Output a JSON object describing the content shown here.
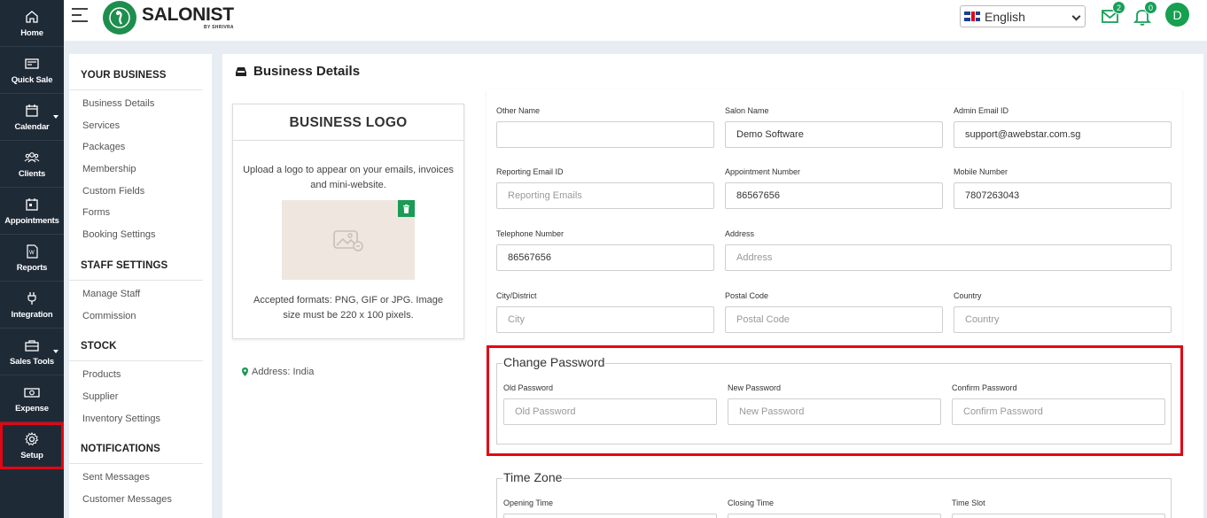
{
  "rail": [
    {
      "label": "Home",
      "icon": "home-icon"
    },
    {
      "label": "Quick Sale",
      "icon": "register-icon"
    },
    {
      "label": "Calendar",
      "icon": "calendar-icon",
      "caret": true
    },
    {
      "label": "Clients",
      "icon": "users-icon"
    },
    {
      "label": "Appointments",
      "icon": "appointment-icon"
    },
    {
      "label": "Reports",
      "icon": "report-icon"
    },
    {
      "label": "Integration",
      "icon": "plug-icon"
    },
    {
      "label": "Sales Tools",
      "icon": "briefcase-icon",
      "caret": true
    },
    {
      "label": "Expense",
      "icon": "money-icon"
    },
    {
      "label": "Setup",
      "icon": "gear-icon",
      "active": true
    }
  ],
  "header": {
    "brand": "SALONIST",
    "brand_sub": "BY SHRIVRA",
    "language": "English",
    "mail_badge": "2",
    "bell_badge": "0",
    "avatar": "D"
  },
  "subnav": {
    "sections": [
      {
        "title": "YOUR BUSINESS",
        "items": [
          "Business Details",
          "Services",
          "Packages",
          "Membership",
          "Custom Fields",
          "Forms",
          "Booking Settings"
        ]
      },
      {
        "title": "STAFF SETTINGS",
        "items": [
          "Manage Staff",
          "Commission"
        ]
      },
      {
        "title": "STOCK",
        "items": [
          "Products",
          "Supplier",
          "Inventory Settings"
        ]
      },
      {
        "title": "NOTIFICATIONS",
        "items": [
          "Sent Messages",
          "Customer Messages"
        ]
      }
    ]
  },
  "main": {
    "title": "Business Details",
    "logo_card": {
      "title": "BUSINESS LOGO",
      "description": "Upload a logo to appear on your emails, invoices and mini-website.",
      "formats": "Accepted formats: PNG, GIF or JPG. Image size must be 220 x 100 pixels."
    },
    "address_note": "Address: India",
    "fields": {
      "other_name": {
        "label": "Other Name",
        "value": "",
        "placeholder": ""
      },
      "salon_name": {
        "label": "Salon Name",
        "value": "Demo Software"
      },
      "admin_email": {
        "label": "Admin Email ID",
        "value": "support@awebstar.com.sg"
      },
      "reporting_email": {
        "label": "Reporting Email ID",
        "placeholder": "Reporting Emails"
      },
      "appointment_number": {
        "label": "Appointment Number",
        "value": "86567656"
      },
      "mobile_number": {
        "label": "Mobile Number",
        "value": "7807263043"
      },
      "telephone_number": {
        "label": "Telephone Number",
        "value": "86567656"
      },
      "address": {
        "label": "Address",
        "placeholder": "Address"
      },
      "city": {
        "label": "City/District",
        "placeholder": "City"
      },
      "postal_code": {
        "label": "Postal Code",
        "placeholder": "Postal Code"
      },
      "country": {
        "label": "Country",
        "placeholder": "Country"
      }
    },
    "change_password": {
      "legend": "Change Password",
      "old": {
        "label": "Old Password",
        "placeholder": "Old Password"
      },
      "new": {
        "label": "New Password",
        "placeholder": "New Password"
      },
      "confirm": {
        "label": "Confirm Password",
        "placeholder": "Confirm Password"
      }
    },
    "time_zone": {
      "legend": "Time Zone",
      "opening": {
        "label": "Opening Time"
      },
      "closing": {
        "label": "Closing Time"
      },
      "slot": {
        "label": "Time Slot"
      }
    }
  }
}
